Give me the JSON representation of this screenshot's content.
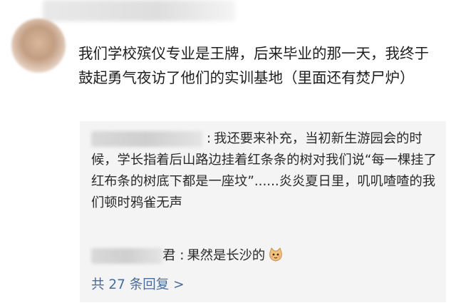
{
  "comment": {
    "text": "我们学校殡仪专业是王牌，后来毕业的那一天，我终于鼓起勇气夜访了他们的实训基地（里面还有焚尸炉）"
  },
  "replies": [
    {
      "separator": ":",
      "text": "我还要来补充，当初新生游园会的时候，学长指着后山路边挂着红条条的树对我们说“每一棵挂了红布条的树底下都是一座坟”......炎炎夏日里，叽叽喳喳的我们顿时鸦雀无声"
    },
    {
      "visible_name_fragment": "君",
      "separator": ":",
      "text": "果然是长沙的",
      "emoji_icon": "cat-emoji-icon"
    }
  ],
  "more_replies": {
    "label": "共 27 条回复 >"
  },
  "colors": {
    "link": "#4b6b9a",
    "reply_background": "#f4f4f4"
  }
}
